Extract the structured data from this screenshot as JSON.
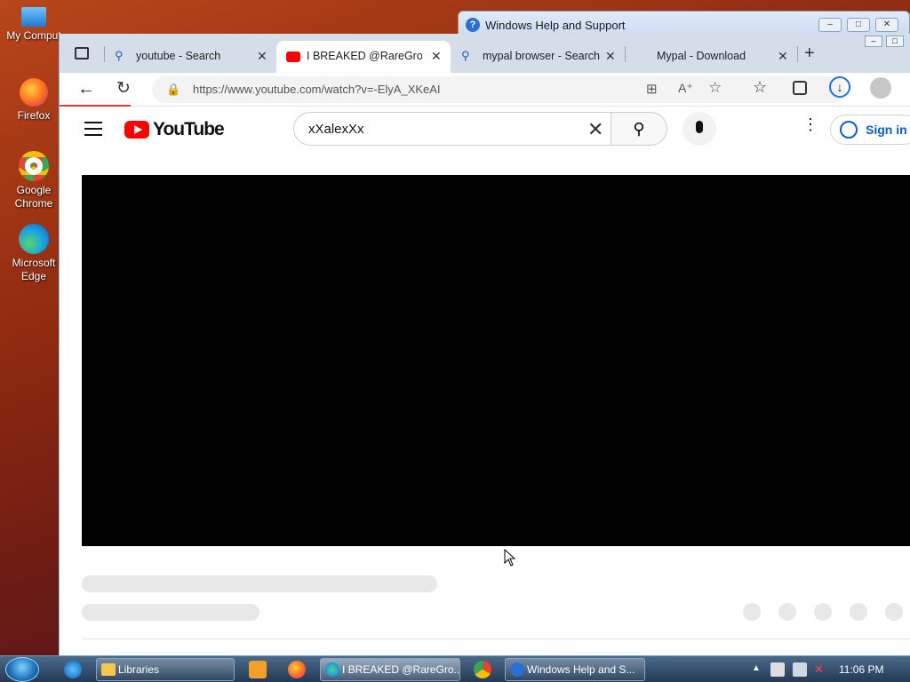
{
  "desktop": {
    "icons": [
      {
        "label": "My Comput"
      },
      {
        "label": "Firefox"
      },
      {
        "label": "Google Chrome"
      },
      {
        "label": "Microsoft Edge"
      }
    ]
  },
  "help_window": {
    "title": "Windows Help and Support"
  },
  "browser": {
    "tabs": [
      {
        "label": "youtube - Search",
        "active": false
      },
      {
        "label": "I BREAKED @RareGroup",
        "active": true
      },
      {
        "label": "mypal browser - Search",
        "active": false
      },
      {
        "label": "Mypal - Download",
        "active": false
      }
    ],
    "new_tab_symbol": "+",
    "url": "https://www.youtube.com/watch?v=-ElyA_XKeAI"
  },
  "youtube": {
    "logo_text": "YouTube",
    "search_value": "xXalexXx",
    "sign_in_label": "Sign in"
  },
  "taskbar": {
    "items": [
      {
        "label": "Libraries"
      },
      {
        "label": "I BREAKED @RareGro..."
      },
      {
        "label": "Windows Help and S..."
      }
    ],
    "clock": "11:06 PM"
  },
  "colors": {
    "youtube_red": "#ff0000",
    "link_blue": "#065fd4"
  }
}
